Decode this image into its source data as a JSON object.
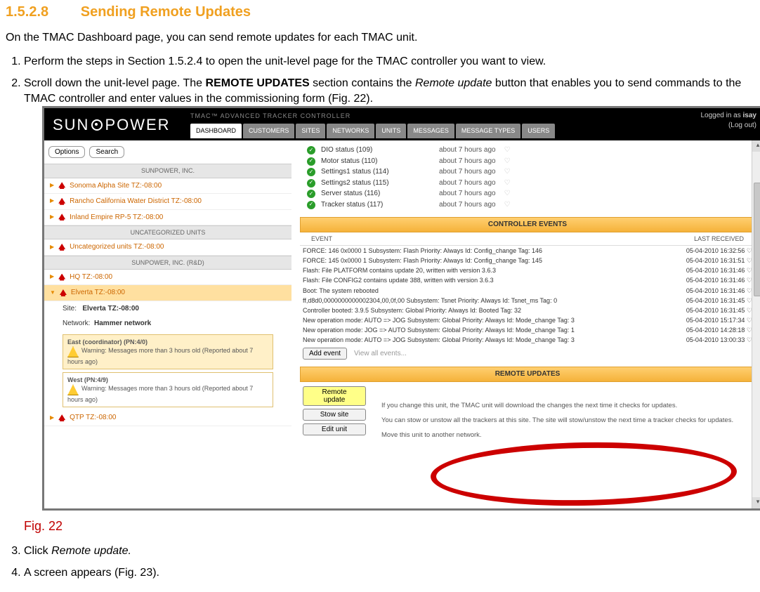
{
  "doc": {
    "section_number": "1.5.2.8",
    "section_title": "Sending Remote Updates",
    "intro": "On the TMAC Dashboard page, you can send remote updates  for each TMAC unit.",
    "step1": "Perform the steps in Section 1.5.2.4 to open the unit-level page for the TMAC controller you want to view.",
    "step2_a": "Scroll down the unit-level page. The ",
    "step2_bold": "REMOTE UPDATES",
    "step2_b": " section contains the ",
    "step2_em": "Remote update",
    "step2_c": " button that enables you to send commands to the TMAC controller and enter values in the commissioning form (Fig. 22).",
    "fig_caption": "Fig. 22",
    "step3_a": "Click ",
    "step3_em": "Remote update.",
    "step4": "A screen appears (Fig. 23)."
  },
  "ui": {
    "brand_a": "SUN",
    "brand_b": "POWER",
    "app_title": "TMAC™ ADVANCED TRACKER CONTROLLER",
    "login_prefix": "Logged in as ",
    "login_user": "isay",
    "logout": "(Log out)",
    "tabs": [
      "DASHBOARD",
      "CUSTOMERS",
      "SITES",
      "NETWORKS",
      "UNITS",
      "MESSAGES",
      "MESSAGE TYPES",
      "USERS"
    ],
    "sidebar": {
      "btn_options": "Options",
      "btn_search": "Search",
      "hdr1": "SUNPOWER, INC.",
      "items1": [
        "Sonoma Alpha Site TZ:-08:00",
        "Rancho California Water District TZ:-08:00",
        "Inland Empire RP-5 TZ:-08:00"
      ],
      "hdr2": "UNCATEGORIZED UNITS",
      "items2": [
        "Uncategorized units TZ:-08:00"
      ],
      "hdr3": "SUNPOWER, INC. (R&D)",
      "items3": [
        "HQ TZ:-08:00"
      ],
      "sel_item": "Elverta TZ:-08:00",
      "site_lbl": "Site:",
      "site_val": "Elverta TZ:-08:00",
      "net_lbl": "Network:",
      "net_val": "Hammer network",
      "card1_title": "East (coordinator) (PN:4/0)",
      "card1_warn": "Warning: Messages more than 3 hours old (Reported about 7 hours ago)",
      "card2_title": "West (PN:4/9)",
      "card2_warn": "Warning: Messages more than 3 hours old (Reported about 7 hours ago)",
      "tail_item": "QTP TZ:-08:00"
    },
    "status": [
      {
        "name": "DIO status (109)",
        "time": "about 7 hours ago"
      },
      {
        "name": "Motor status (110)",
        "time": "about 7 hours ago"
      },
      {
        "name": "Settings1 status (114)",
        "time": "about 7 hours ago"
      },
      {
        "name": "Settings2 status (115)",
        "time": "about 7 hours ago"
      },
      {
        "name": "Server status (116)",
        "time": "about 7 hours ago"
      },
      {
        "name": "Tracker status (117)",
        "time": "about 7 hours ago"
      }
    ],
    "events": {
      "panel_title": "CONTROLLER EVENTS",
      "col_event": "EVENT",
      "col_time": "LAST RECEIVED",
      "rows": [
        {
          "t": "FORCE: 146 0x0000 1 Subsystem: Flash Priority: Always Id: Config_change Tag: 146",
          "ts": "05-04-2010 16:32:56 ♡"
        },
        {
          "t": "FORCE: 145 0x0000 1 Subsystem: Flash Priority: Always Id: Config_change Tag: 145",
          "ts": "05-04-2010 16:31:51 ♡"
        },
        {
          "t": "Flash: File PLATFORM contains update 20, written with version 3.6.3",
          "ts": "05-04-2010 16:31:46 ♡"
        },
        {
          "t": "Flash: File CONFIG2 contains update 388, written with version 3.6.3",
          "ts": "05-04-2010 16:31:46 ♡"
        },
        {
          "t": "Boot: The system rebooted",
          "ts": "05-04-2010 16:31:46 ♡"
        },
        {
          "t": "ff,d8d0,0000000000002304,00,0f,00 Subsystem: Tsnet Priority: Always Id: Tsnet_ms Tag: 0",
          "ts": "05-04-2010 16:31:45 ♡"
        },
        {
          "t": "Controller booted: 3.9.5 Subsystem: Global Priority: Always Id: Booted Tag: 32",
          "ts": "05-04-2010 16:31:45 ♡"
        },
        {
          "t": "New operation mode: AUTO => JOG Subsystem: Global Priority: Always Id: Mode_change Tag: 3",
          "ts": "05-04-2010 15:17:34 ♡"
        },
        {
          "t": "New operation mode: JOG => AUTO Subsystem: Global Priority: Always Id: Mode_change Tag: 1",
          "ts": "05-04-2010 14:28:18 ♡"
        },
        {
          "t": "New operation mode: AUTO => JOG Subsystem: Global Priority: Always Id: Mode_change Tag: 3",
          "ts": "05-04-2010 13:00:33 ♡"
        }
      ],
      "add_event": "Add event",
      "view_all": "View all events..."
    },
    "remote": {
      "panel_title": "REMOTE UPDATES",
      "btn_update": "Remote update",
      "btn_stow": "Stow site",
      "btn_edit": "Edit unit",
      "line1": "If you change this unit, the TMAC unit will download the changes the next time it checks for updates.",
      "line2": "You can stow or unstow all the trackers at this site. The site will stow/unstow the next time a tracker checks for updates.",
      "line3": "Move this unit to another network."
    }
  }
}
